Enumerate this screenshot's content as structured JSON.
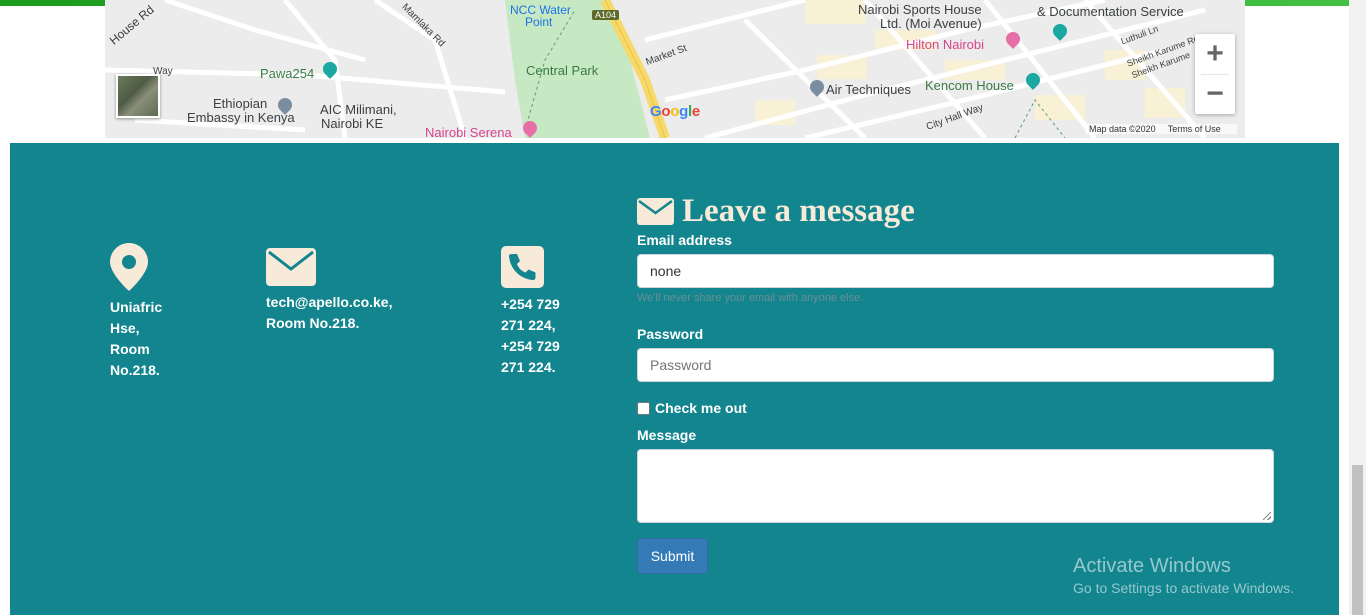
{
  "map": {
    "labels": {
      "house_rd": "House Rd",
      "mamlaka_rd": "Mamlaka Rd",
      "ncc_water": "NCC Water",
      "ncc_point": "Point",
      "a104": "A104",
      "sports_house1": "Nairobi Sports House",
      "sports_house2": "Ltd. (Moi Avenue)",
      "doc_service": "& Documentation Service",
      "way": "Way",
      "pawa": "Pawa254",
      "central_park": "Central Park",
      "market_st": "Market St",
      "hilton": "Hilton Nairobi",
      "luthuli": "Luthuli Ln",
      "sheikh1": "Sheikh Karume Rd",
      "sheikh2": "Sheikh Karume",
      "ethiopian1": "Ethiopian",
      "ethiopian2": "Embassy in Kenya",
      "aic1": "AIC Milimani,",
      "aic2": "Nairobi KE",
      "air_tech": "Air Techniques",
      "kencom": "Kencom House",
      "city_hall": "City Hall Way",
      "serena": "Nairobi Serena",
      "google": "Google"
    },
    "zoom_in": "+",
    "zoom_out": "−",
    "map_data": "Map data ©2020",
    "terms": "Terms of Use"
  },
  "contact": {
    "address": "Uniafric\nHse,\nRoom\nNo.218.",
    "email": "tech@apello.co.ke,\nRoom No.218.",
    "phone": "+254 729\n271 224,\n+254 729\n271 224."
  },
  "form": {
    "title": "Leave a message",
    "email_label": "Email address",
    "email_value": "none",
    "email_hint": "We'll never share your email with anyone else.",
    "password_label": "Password",
    "password_placeholder": "Password",
    "check_label": "Check me out",
    "message_label": "Message",
    "submit_label": "Submit"
  },
  "watermark": {
    "line1": "Activate Windows",
    "line2": "Go to Settings to activate Windows."
  },
  "colors": {
    "footer_bg": "#12858f",
    "icon_cream": "#f7ead8",
    "submit_bg": "#337ab7"
  }
}
